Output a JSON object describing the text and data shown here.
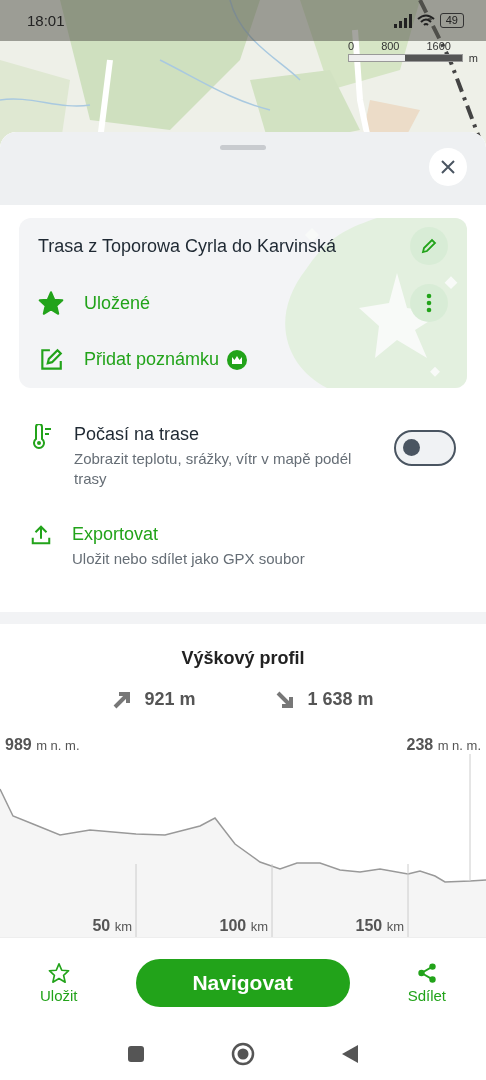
{
  "status_bar": {
    "time": "18:01",
    "battery": "49"
  },
  "map": {
    "scale_labels": [
      "0",
      "800",
      "1600"
    ],
    "scale_unit": "m"
  },
  "route_card": {
    "title": "Trasa z Toporowa Cyrla do Karvinská",
    "saved_label": "Uložené",
    "saved": true,
    "note_label": "Přidat poznámku"
  },
  "options": [
    {
      "kind": "toggle",
      "title": "Počasí na trase",
      "description": "Zobrazit teplotu, srážky, vítr v mapě podél trasy",
      "on": false
    },
    {
      "kind": "action",
      "title": "Exportovat",
      "description": "Uložit nebo sdílet jako GPX soubor"
    }
  ],
  "elevation": {
    "title": "Výškový profil",
    "ascent": "921 m",
    "descent": "1 638 m",
    "start": {
      "value": "989",
      "unit": "m n. m."
    },
    "end": {
      "value": "238",
      "unit": "m n. m."
    },
    "distance_ticks": [
      {
        "value": "50",
        "unit": "km"
      },
      {
        "value": "100",
        "unit": "km"
      },
      {
        "value": "150",
        "unit": "km"
      }
    ]
  },
  "bottom_bar": {
    "save_label": "Uložit",
    "navigate_label": "Navigovat",
    "share_label": "Sdílet"
  }
}
